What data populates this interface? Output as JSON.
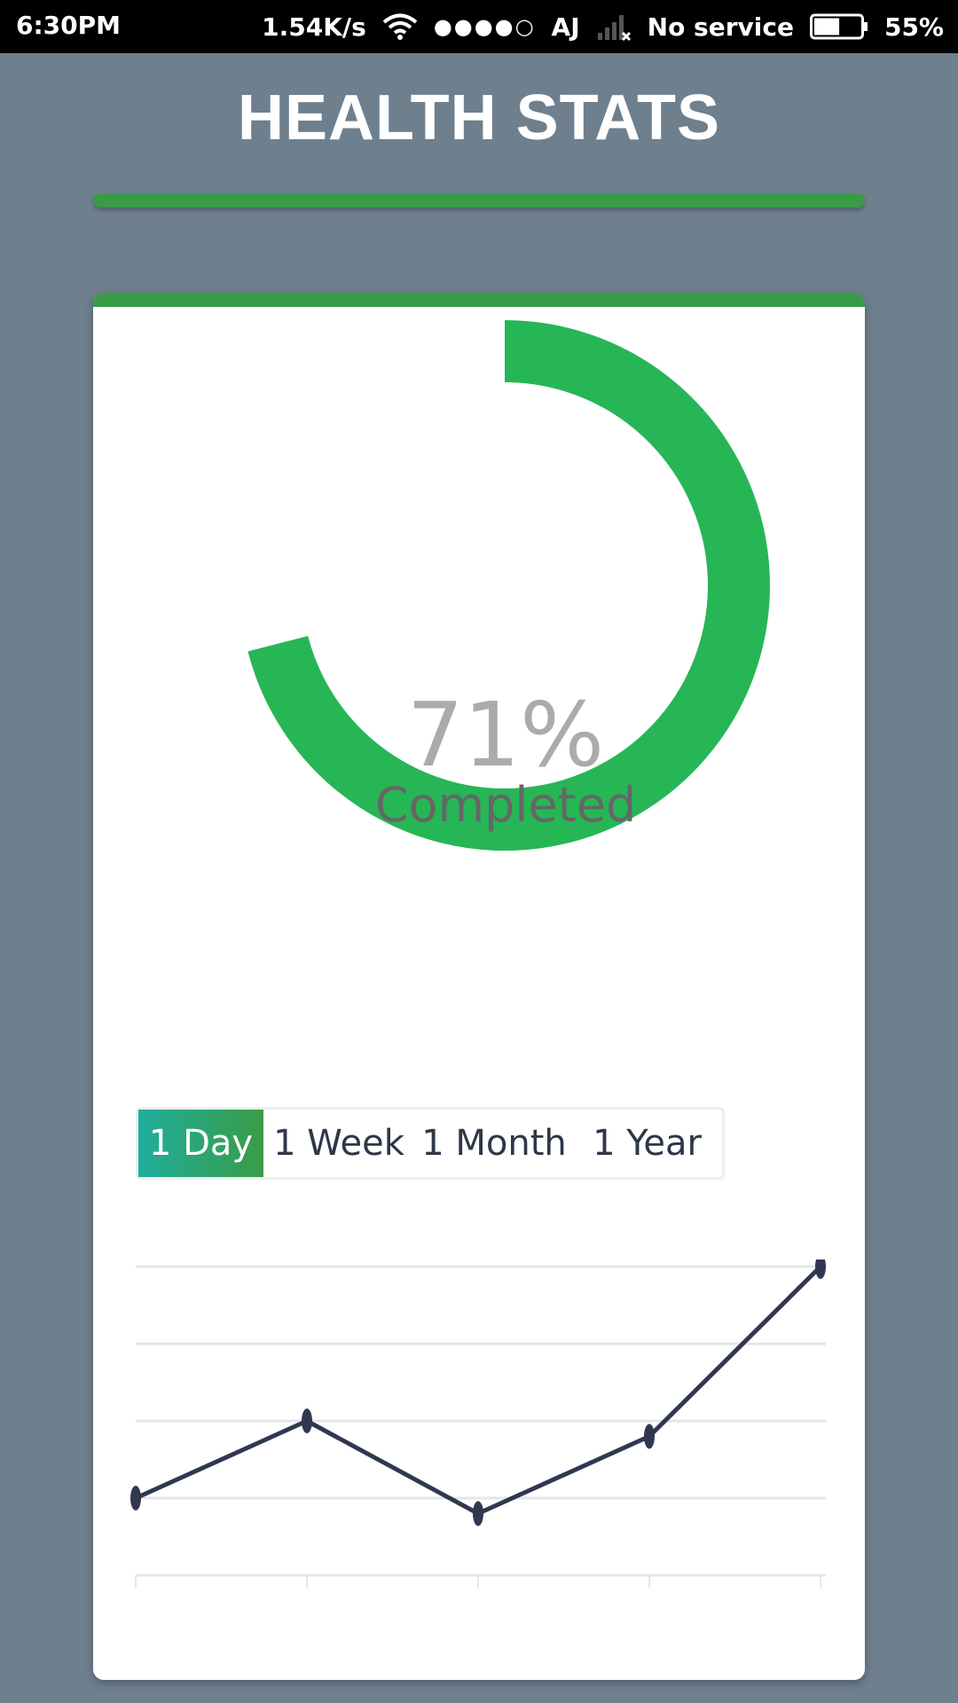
{
  "status_bar": {
    "time": "6:30PM",
    "net_speed": "1.54K/s",
    "sim_dots": "●●●●○",
    "carrier": "AJ",
    "service": "No service",
    "battery": "55%",
    "battery_level": 0.55,
    "icons": [
      "wifi-icon",
      "signal-icon",
      "battery-icon"
    ]
  },
  "header": {
    "title": "HEALTH STATS"
  },
  "progress": {
    "percent_text": "71%",
    "value": 71,
    "label": "Completed",
    "color": "#26b656"
  },
  "tabs": [
    {
      "label": "1 Day",
      "active": true
    },
    {
      "label": "1 Week",
      "active": false
    },
    {
      "label": "1 Month",
      "active": false
    },
    {
      "label": "1 Year",
      "active": false
    }
  ],
  "colors": {
    "background": "#6e7f8e",
    "accent_green": "#3a9b47",
    "ring_green": "#26b656",
    "line": "#303850",
    "grid": "#e4e6ea"
  },
  "chart_data": {
    "type": "line",
    "title": "",
    "xlabel": "",
    "ylabel": "",
    "x": [
      0,
      1,
      2,
      3,
      4
    ],
    "series": [
      {
        "values": [
          1,
          2,
          0.8,
          1.8,
          4
        ]
      }
    ],
    "ylim": [
      0,
      4
    ],
    "grid": true,
    "legend": "none"
  }
}
